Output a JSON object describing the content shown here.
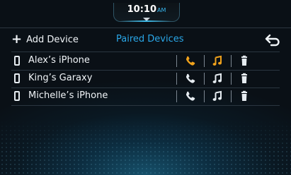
{
  "status_bar": {
    "time": "10:10",
    "ampm": "AM"
  },
  "header": {
    "add_device_label": "Add Device",
    "title": "Paired Devices"
  },
  "devices": [
    {
      "name": "Alex’s iPhone",
      "call_active": true,
      "media_active": true
    },
    {
      "name": "King’s Garaxy",
      "call_active": false,
      "media_active": false
    },
    {
      "name": "Michelle’s iPhone",
      "call_active": false,
      "media_active": false
    }
  ],
  "colors": {
    "accent_blue": "#2aa7e8",
    "active_orange": "#f0a21c",
    "inactive_icon": "#e6ecf1",
    "background": "#0a1016"
  },
  "icons": {
    "add": "plus-icon",
    "back": "back-arrow-icon",
    "device": "smartphone-icon",
    "call": "phone-call-icon",
    "media": "music-note-icon",
    "delete": "trash-icon"
  }
}
